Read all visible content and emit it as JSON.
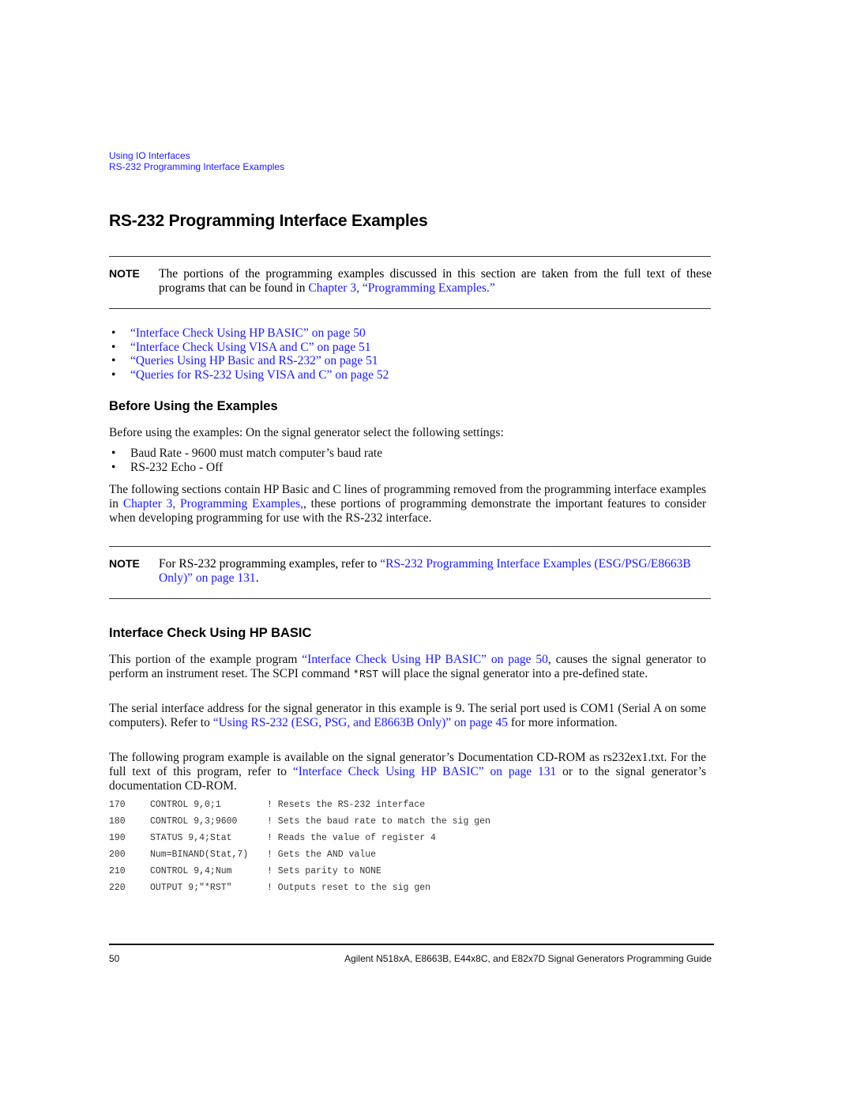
{
  "breadcrumb": {
    "items": [
      "Using IO Interfaces",
      "RS-232 Programming Interface Examples"
    ]
  },
  "page_title": "RS-232 Programming Interface Examples",
  "note1": {
    "label": "NOTE",
    "text_before": "The portions of the programming examples discussed in this section are taken from the full text of these programs that can be found in ",
    "link": "Chapter 3, “Programming Examples.”",
    "text_after": ""
  },
  "bullet_links": [
    "“Interface Check Using HP BASIC” on page 50",
    "“Interface Check Using VISA and C” on page 51",
    "“Queries Using HP Basic and RS-232” on page 51",
    "“Queries for RS-232 Using VISA and C” on page 52"
  ],
  "section1": {
    "heading": "Before Using the Examples",
    "intro": "Before using the examples: On the signal generator select the following settings:",
    "settings": [
      "Baud Rate -  9600 must match computer’s baud rate",
      "RS-232 Echo -  Off"
    ],
    "para_before": "The following sections contain HP Basic and C lines of programming removed from the programming interface examples in ",
    "para_link": "Chapter 3, Programming Examples,",
    "para_after": ", these portions of programming demonstrate the important features to consider when developing programming for use with the RS-232 interface."
  },
  "note2": {
    "label": "NOTE",
    "text_before": "For RS-232 programming examples, refer to ",
    "link": "“RS-232 Programming Interface Examples (ESG/PSG/E8663B Only)” on page 131",
    "text_after": "."
  },
  "section2": {
    "heading": "Interface Check Using HP BASIC",
    "p1_before": "This portion of the example program ",
    "p1_link": "“Interface Check Using HP BASIC” on page 50",
    "p1_mid": ", causes the signal generator to perform an instrument reset. The SCPI command ",
    "p1_code": "*RST",
    "p1_after": " will place the signal generator into a pre-defined state.",
    "p2_before": "The serial interface address for the signal generator in this example is 9. The serial port used is COM1 (Serial A on some computers). Refer to ",
    "p2_link": "“Using RS-232 (ESG, PSG, and E8663B Only)” on page 45",
    "p2_after": " for more information.",
    "p3_before": "The following program example is available on the signal generator’s Documentation CD-ROM as rs232ex1.txt. For the full text of this program, refer to ",
    "p3_link": "“Interface Check Using HP BASIC” on page 131",
    "p3_after": " or to the signal generator’s documentation CD-ROM."
  },
  "code_lines": [
    {
      "line": "170",
      "stmt": "CONTROL 9,0;1",
      "comment": "! Resets the RS-232 interface"
    },
    {
      "line": "180",
      "stmt": "CONTROL 9,3;9600",
      "comment": "! Sets the baud rate to match the sig gen"
    },
    {
      "line": "190",
      "stmt": "STATUS 9,4;Stat",
      "comment": "! Reads the value of register 4"
    },
    {
      "line": "200",
      "stmt": "Num=BINAND(Stat,7)",
      "comment": "! Gets the AND value"
    },
    {
      "line": "210",
      "stmt": "CONTROL 9,4;Num",
      "comment": "! Sets parity to NONE"
    },
    {
      "line": "220",
      "stmt": "OUTPUT 9;\"*RST\"",
      "comment": "! Outputs reset to the sig gen"
    }
  ],
  "footer": {
    "page_number": "50",
    "title": "Agilent N518xA, E8663B, E44x8C, and E82x7D Signal Generators Programming Guide"
  },
  "colors": {
    "link": "#1a1aff",
    "text": "#111111"
  }
}
